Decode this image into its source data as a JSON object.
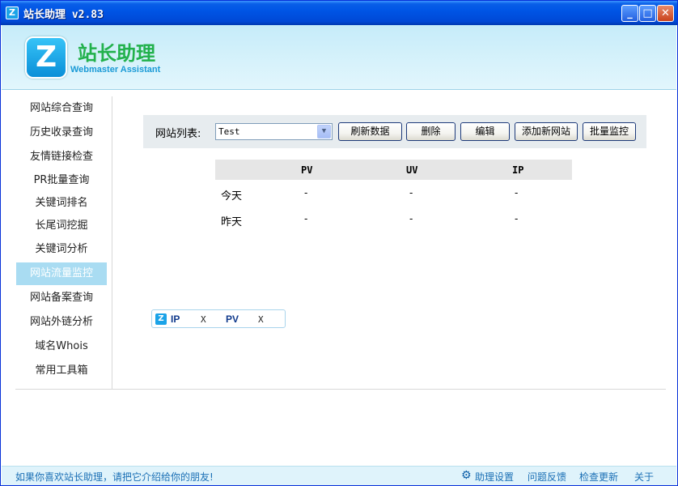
{
  "window": {
    "title": "站长助理  v2.83",
    "icon_letter": "Z",
    "minimize": "_",
    "maximize": "□",
    "close": "✕"
  },
  "header": {
    "logo_letter": "Z",
    "title_cn": "站长助理",
    "title_en": "Webmaster Assistant"
  },
  "sidebar": {
    "items": [
      {
        "label": "网站综合查询"
      },
      {
        "label": "历史收录查询"
      },
      {
        "label": "友情链接检查"
      },
      {
        "label": "PR批量查询"
      },
      {
        "label": "关键词排名"
      },
      {
        "label": "长尾词挖掘"
      },
      {
        "label": "关键词分析"
      },
      {
        "label": "网站流量监控"
      },
      {
        "label": "网站备案查询"
      },
      {
        "label": "网站外链分析"
      },
      {
        "label": "域名Whois"
      },
      {
        "label": "常用工具箱"
      }
    ],
    "active_index": 7
  },
  "toolbar": {
    "site_list_label": "网站列表:",
    "site_select_value": "Test",
    "refresh_label": "刷新数据",
    "delete_label": "删除",
    "edit_label": "编辑",
    "add_label": "添加新网站",
    "batch_label": "批量监控"
  },
  "stats": {
    "headers": [
      "PV",
      "UV",
      "IP"
    ],
    "rows": [
      {
        "label": "今天",
        "values": [
          "-",
          "-",
          "-"
        ]
      },
      {
        "label": "昨天",
        "values": [
          "-",
          "-",
          "-"
        ]
      }
    ]
  },
  "widget": {
    "icon_letter": "Z",
    "ip_label": "IP",
    "ip_value": "X",
    "pv_label": "PV",
    "pv_value": "X"
  },
  "statusbar": {
    "message": "如果你喜欢站长助理，请把它介绍给你的朋友!",
    "settings_label": "助理设置",
    "feedback_label": "问题反馈",
    "update_label": "检查更新",
    "about_label": "关于"
  }
}
